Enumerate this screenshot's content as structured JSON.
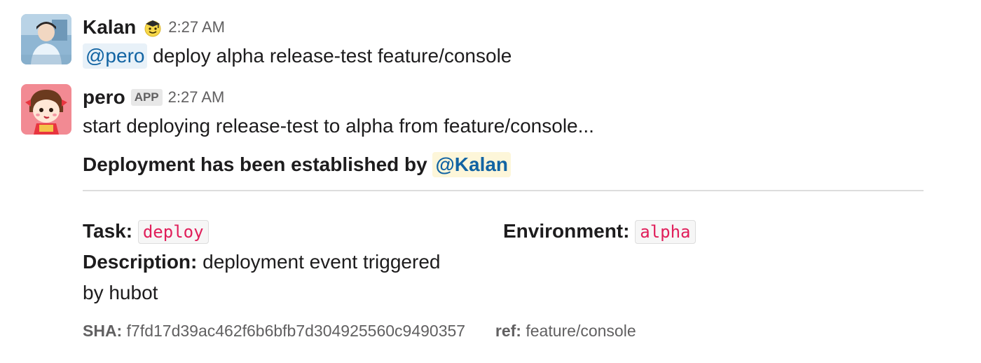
{
  "messages": [
    {
      "author": "Kalan",
      "status_emoji": "graduation-emoji-icon",
      "time": "2:27 AM",
      "mention": "@pero",
      "text": " deploy alpha release-test feature/console"
    },
    {
      "author": "pero",
      "badge": "APP",
      "time": "2:27 AM",
      "text": "start deploying release-test to alpha from feature/console...",
      "attachment": {
        "title": "Deployment has been established by ",
        "title_mention": "@Kalan",
        "fields": {
          "task_label": "Task:",
          "task_value": "deploy",
          "environment_label": "Environment:",
          "environment_value": "alpha",
          "description_label": "Description:",
          "description_value_line1": " deployment event triggered",
          "description_value_line2": "by hubot"
        },
        "footer": {
          "sha_label": "SHA:",
          "sha_value": " f7fd17d39ac462f6b6bfb7d304925560c9490357",
          "ref_label": "ref:",
          "ref_value": " feature/console"
        }
      }
    }
  ],
  "colors": {
    "mention_text": "#1264a3",
    "mention_bg": "#e8f1f8",
    "mention_me_bg": "#fdf6d9",
    "code_text": "#e01e5a"
  }
}
